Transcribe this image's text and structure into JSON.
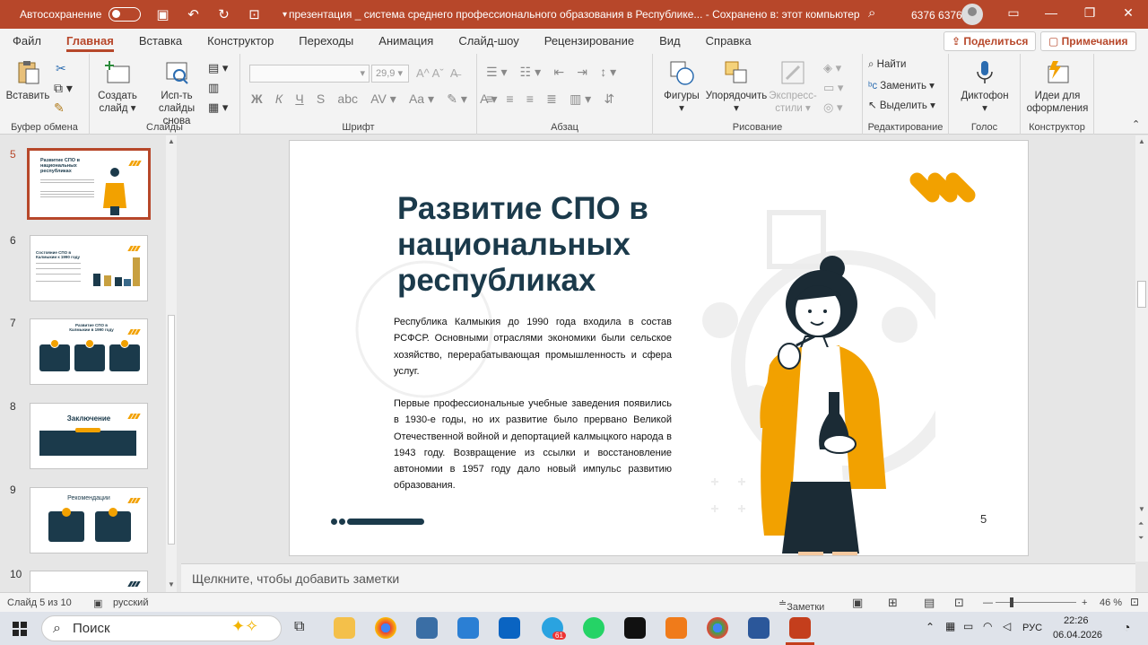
{
  "titlebar": {
    "autosave_label": "Автосохранение",
    "document_title": "презентация _ система среднего профессионального образования в Республике...  -  Сохранено в: этот компьютер",
    "user": "6376 6376"
  },
  "menu": {
    "tabs": [
      "Файл",
      "Главная",
      "Вставка",
      "Конструктор",
      "Переходы",
      "Анимация",
      "Слайд-шоу",
      "Рецензирование",
      "Вид",
      "Справка"
    ],
    "share": "Поделиться",
    "comments": "Примечания"
  },
  "ribbon": {
    "clipboard": {
      "paste": "Вставить",
      "label": "Буфер обмена"
    },
    "slides": {
      "new_slide": "Создать слайд",
      "reuse": "Исп-ть слайды снова",
      "label": "Слайды"
    },
    "font": {
      "size": "29,9",
      "label": "Шрифт"
    },
    "paragraph": {
      "label": "Абзац"
    },
    "drawing": {
      "shapes": "Фигуры",
      "arrange": "Упорядочить",
      "styles": "Экспресс-стили",
      "label": "Рисование"
    },
    "editing": {
      "find": "Найти",
      "replace": "Заменить",
      "select": "Выделить",
      "label": "Редактирование"
    },
    "voice": {
      "dictate": "Диктофон",
      "label": "Голос"
    },
    "designer": {
      "ideas": "Идеи для оформления",
      "label": "Конструктор"
    }
  },
  "thumbnails": [
    {
      "num": "5",
      "title": "Развитие СПО в национальных республиках",
      "selected": true
    },
    {
      "num": "6",
      "title": "Состояние СПО в Калмыкии к 1990 году",
      "selected": false
    },
    {
      "num": "7",
      "title": "Развитие СПО в Калмыкии в 1990 году",
      "selected": false
    },
    {
      "num": "8",
      "title": "Заключение",
      "selected": false
    },
    {
      "num": "9",
      "title": "Рекомендации",
      "selected": false
    },
    {
      "num": "10",
      "title": "",
      "selected": false
    }
  ],
  "slide": {
    "title": "Развитие СПО в национальных республиках",
    "paragraph1": "Республика Калмыкия до 1990 года входила в состав РСФСР. Основными отраслями экономики были сельское хозяйство, перерабатывающая промышленность и сфера услуг.",
    "paragraph2": "Первые профессиональные учебные заведения появились в 1930-е годы, но их развитие было прервано Великой Отечественной войной и депортацией калмыцкого народа в 1943 году. Возвращение из ссылки и восстановление автономии в 1957 году дало новый импульс развитию образования.",
    "number": "5"
  },
  "notes_placeholder": "Щелкните, чтобы добавить заметки",
  "status": {
    "slide_counter": "Слайд 5 из 10",
    "language": "русский",
    "notes_button": "Заметки",
    "zoom": "46 %"
  },
  "taskbar": {
    "search": "Поиск",
    "lang": "РУС",
    "time": "22:26",
    "date": "06.04.2026",
    "telegram_badge": "61"
  },
  "colors": {
    "accent": "#b7472a",
    "slide_title": "#1b3a4b",
    "orange": "#f2a100"
  }
}
